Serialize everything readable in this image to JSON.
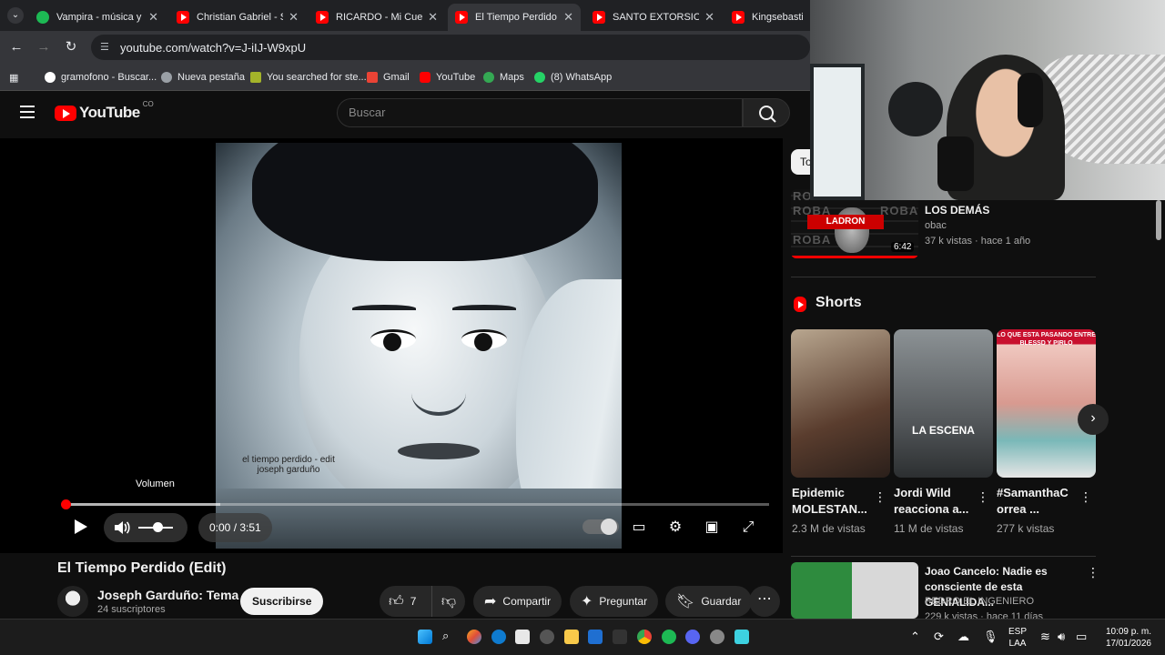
{
  "browser": {
    "tabs": [
      {
        "title": "Vampira - música y le",
        "favicon": "spotify-icon"
      },
      {
        "title": "Christian Gabriel - SE",
        "favicon": "youtube-icon"
      },
      {
        "title": "RICARDO - Mi Cuerpo",
        "favicon": "youtube-icon"
      },
      {
        "title": "El Tiempo Perdido (E",
        "favicon": "youtube-icon",
        "active": true
      },
      {
        "title": "SANTO EXTORSIONA",
        "favicon": "youtube-icon"
      },
      {
        "title": "KingsebastianO",
        "favicon": "youtube-icon"
      }
    ],
    "url": "youtube.com/watch?v=J-iIJ-W9xpU",
    "bookmarks": [
      {
        "label": "gramofono - Buscar...",
        "icon": "google-icon"
      },
      {
        "label": "Nueva pestaña",
        "icon": "globe-icon"
      },
      {
        "label": "You searched for ste...",
        "icon": "bookmark-icon"
      },
      {
        "label": "Gmail",
        "icon": "gmail-icon"
      },
      {
        "label": "YouTube",
        "icon": "youtube-icon"
      },
      {
        "label": "Maps",
        "icon": "maps-icon"
      },
      {
        "label": "(8) WhatsApp",
        "icon": "whatsapp-icon"
      }
    ]
  },
  "youtube": {
    "logo_text": "YouTube",
    "country": "CO",
    "search_placeholder": "Buscar"
  },
  "player": {
    "tooltip": "Volumen",
    "time": "0:00 / 3:51",
    "progress_fraction": 0.0,
    "volume_fraction": 0.55,
    "overlay_caption_line1": "el tiempo perdido - edit",
    "overlay_caption_line2": "joseph garduño"
  },
  "video": {
    "title": "El Tiempo Perdido (Edit)",
    "channel": "Joseph Garduño: Tema",
    "subscribers": "24 suscriptores",
    "subscribe_label": "Suscribirse",
    "likes": "7",
    "share_label": "Compartir",
    "ask_label": "Preguntar",
    "save_label": "Guardar"
  },
  "sidebar": {
    "chip": "To",
    "recommended": {
      "thumb_text": "ROBA",
      "thumb_badge": "LADRON",
      "duration": "6:42",
      "title": "LOS DEMÁS",
      "channel": "obac",
      "meta": "37 k vistas · hace 1 año"
    },
    "shorts_heading": "Shorts",
    "shorts": [
      {
        "title": "Epidemic MOLESTAN...",
        "views": "2.3 M de vistas",
        "overlay": ""
      },
      {
        "title": "Jordi Wild reacciona a...",
        "views": "11 M de vistas",
        "overlay": "LA ESCENA"
      },
      {
        "title": "#SamanthaC orrea ...",
        "views": "277 k vistas",
        "overlay": "LO QUE ESTA PASANDO ENTRE BLESSD Y PIRLO"
      }
    ],
    "recommended2": {
      "title": "Joao Cancelo: Nadie es consciente de esta GENIALIDA...",
      "channel": "PEDRO EL INGENIERO",
      "meta": "229 k vistas · hace 11 días"
    }
  },
  "taskbar": {
    "lang_line1": "ESP",
    "lang_line2": "LAA",
    "time": "10:09 p. m.",
    "date": "17/01/2026"
  }
}
